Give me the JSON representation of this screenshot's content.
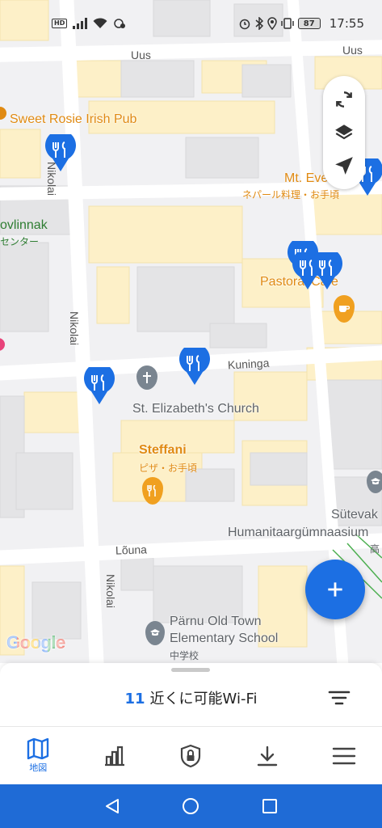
{
  "status_bar": {
    "hd_label": "HD",
    "battery": "87",
    "time": "17:55"
  },
  "map": {
    "streets": {
      "uus_left": "Uus",
      "uus_right": "Uus",
      "nikolai_top": "Nikolai",
      "nikolai_mid": "Nikolai",
      "nikolai_bottom": "Nikolai",
      "kuninga": "Kuninga",
      "louna": "Lõuna"
    },
    "pois": {
      "sweet_rosie": "Sweet Rosie Irish Pub",
      "mt_everest": "Mt. Eve",
      "mt_everest_sub": "ネパール料理・お手頃",
      "vlinnak": "ovlinnak",
      "vlinnak_sub": "センター",
      "pastoral": "Pastoral Cafe",
      "church": "St. Elizabeth's Church",
      "steffani": "Steffani",
      "steffani_sub": "ピザ・お手頃",
      "sutevak": "Sütevak",
      "humanitaar": "Humanitaargümnaasium",
      "humanitaar_sub": "高",
      "school_line1": "Pärnu Old Town",
      "school_line2": "Elementary School",
      "school_sub": "中学校"
    },
    "google_logo": "Google",
    "colors": {
      "pin_blue": "#1c6fe3",
      "poi_orange": "#e08a12",
      "building_yellow": "#fdf0c8",
      "building_grey": "#e4e4e6"
    }
  },
  "map_controls": [
    "refresh-icon",
    "layers-icon",
    "my-location-icon"
  ],
  "fab": {
    "icon": "plus-icon"
  },
  "sheet": {
    "count": "11",
    "title": "近くに可能Wi-Fi"
  },
  "bottom_nav": {
    "map_label": "地図",
    "items": [
      "map-icon",
      "stats-icon",
      "vpn-shield-icon",
      "download-icon",
      "menu-icon"
    ]
  },
  "system_nav": [
    "back-icon",
    "home-icon",
    "recents-icon"
  ]
}
